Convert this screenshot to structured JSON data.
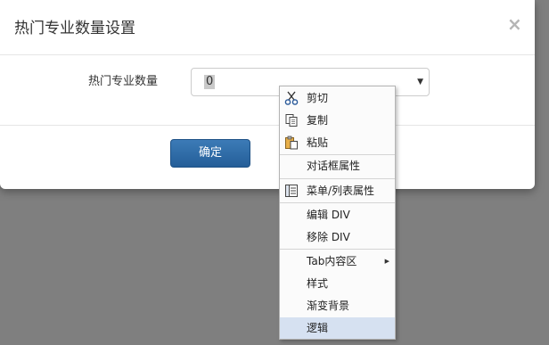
{
  "dialog": {
    "title": "热门专业数量设置",
    "close_label": "×",
    "field_label": "热门专业数量",
    "select_value": "0",
    "ok_label": "确定"
  },
  "context_menu": {
    "items": [
      {
        "label": "剪切",
        "icon": "scissors-icon"
      },
      {
        "label": "复制",
        "icon": "copy-icon"
      },
      {
        "label": "粘贴",
        "icon": "paste-icon"
      },
      {
        "label": "对话框属性"
      },
      {
        "label": "菜单/列表属性",
        "icon": "list-icon"
      },
      {
        "label": "编辑 DIV"
      },
      {
        "label": "移除 DIV"
      },
      {
        "label": "Tab内容区",
        "submenu": true
      },
      {
        "label": "样式"
      },
      {
        "label": "渐变背景"
      },
      {
        "label": "逻辑",
        "highlighted": true
      }
    ]
  },
  "colors": {
    "overlay": "#7f7f7f",
    "primary_button": "#2d6aa8",
    "menu_highlight": "#d6e1f1"
  }
}
